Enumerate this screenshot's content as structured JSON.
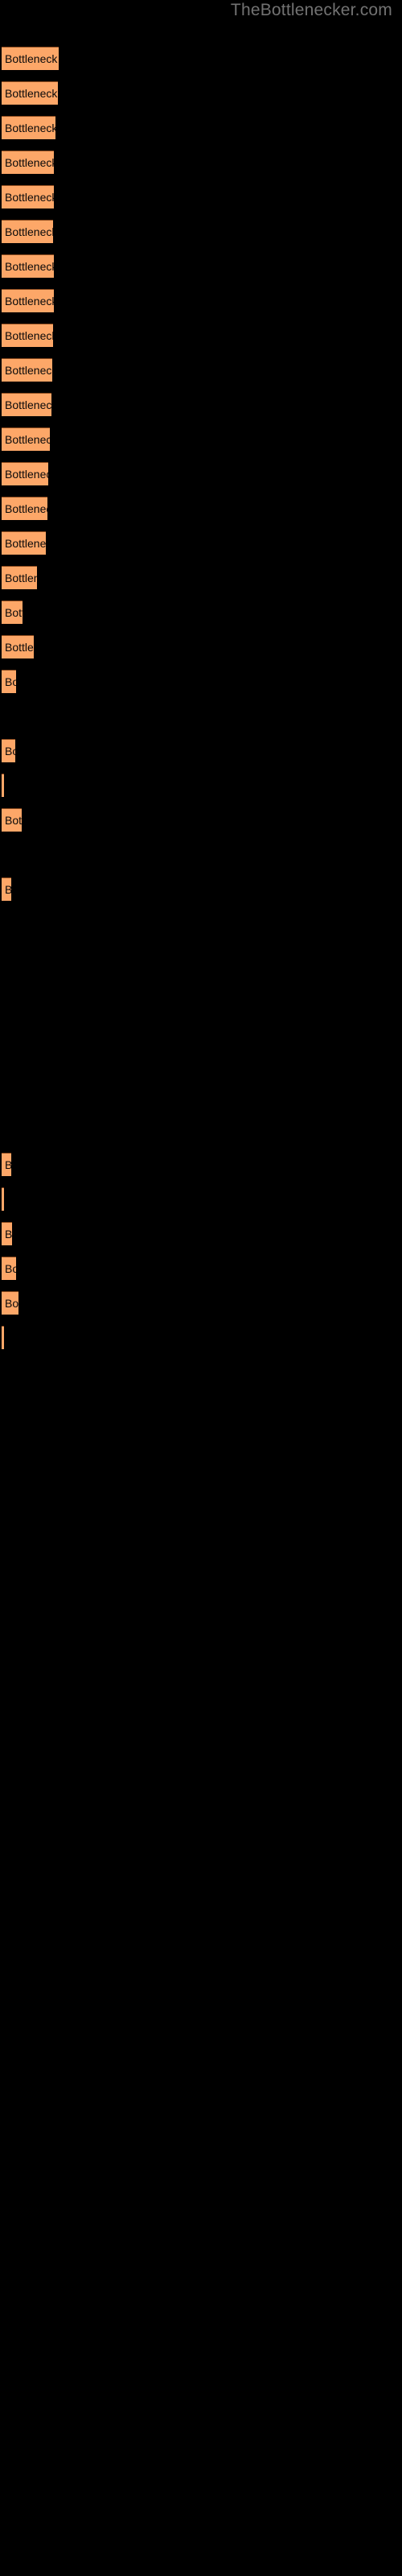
{
  "watermark": {
    "text": "TheBottlenecker.com",
    "color": "#727272"
  },
  "colors": {
    "background": "#000000",
    "bar_fill": "#fda768",
    "bar_border_top": "#8a4a1e",
    "bar_label_text": "#0a0a0a"
  },
  "chart_data": {
    "type": "bar",
    "orientation": "horizontal",
    "title": "",
    "subtitle": "",
    "xlabel": "",
    "ylabel": "",
    "grid": false,
    "legend": null,
    "axis_visible": false,
    "tick_labels": [],
    "xlim": [
      0,
      500
    ],
    "bar_label_template": "Bottleneck result",
    "note": "Horizontal bar chart; every bar carries the same clipped in-bar label 'Bottleneck result'. Bar widths in pixels measured from the left edge of the plotting area.",
    "categories": [
      "bar-1",
      "bar-2",
      "bar-3",
      "bar-4",
      "bar-5",
      "bar-6",
      "bar-7",
      "bar-8",
      "bar-9",
      "bar-10",
      "bar-11",
      "bar-12",
      "bar-13",
      "bar-14",
      "bar-15",
      "bar-16",
      "bar-17",
      "bar-18",
      "bar-19",
      "bar-20",
      "bar-21",
      "bar-22",
      "bar-23",
      "bar-24",
      "bar-25",
      "bar-26",
      "bar-27",
      "bar-28",
      "bar-29",
      "bar-30",
      "bar-31",
      "bar-32",
      "bar-33",
      "bar-34",
      "bar-35",
      "bar-36",
      "bar-37",
      "bar-38"
    ],
    "values": [
      71,
      70,
      67,
      65,
      65,
      63,
      65,
      65,
      64,
      62,
      62,
      58,
      57,
      55,
      50,
      44,
      33,
      44,
      27,
      0,
      25,
      10,
      30,
      0,
      18,
      0,
      0,
      0,
      0,
      18,
      10,
      20,
      23,
      25,
      10,
      0,
      0,
      0
    ],
    "labels": [
      "Bottleneck result",
      "Bottleneck result",
      "Bottleneck result",
      "Bottleneck result",
      "Bottleneck result",
      "Bottleneck result",
      "Bottleneck result",
      "Bottleneck result",
      "Bottleneck result",
      "Bottleneck result",
      "Bottleneck result",
      "Bottleneck result",
      "Bottleneck result",
      "Bottleneck result",
      "Bottleneck result",
      "Bottleneck result",
      "Bottleneck result",
      "Bottleneck result",
      "Bottleneck result",
      "",
      "Bottleneck result",
      "Bottleneck result",
      "Bottleneck result",
      "",
      "Bottleneck result",
      "",
      "",
      "",
      "",
      "Bottleneck result",
      "Bottleneck result",
      "Bottleneck result",
      "Bottleneck result",
      "Bottleneck result",
      "Bottleneck result",
      "",
      "",
      ""
    ],
    "tops": [
      58,
      101,
      144,
      187,
      230,
      273,
      316,
      359,
      402,
      445,
      488,
      531,
      574,
      617,
      660,
      703,
      746,
      789,
      832,
      875,
      918,
      961,
      1004,
      1047,
      1090,
      1133,
      1176,
      1219,
      1262,
      1305,
      1348,
      1391,
      1434,
      1477,
      1520,
      1563,
      1606,
      1649
    ]
  },
  "rows": [
    {
      "top": 58,
      "width": 71,
      "label": "Bottleneck result"
    },
    {
      "top": 101,
      "width": 70,
      "label": "Bottleneck result"
    },
    {
      "top": 144,
      "width": 67,
      "label": "Bottleneck result"
    },
    {
      "top": 187,
      "width": 65,
      "label": "Bottleneck result"
    },
    {
      "top": 230,
      "width": 65,
      "label": "Bottleneck result"
    },
    {
      "top": 273,
      "width": 64,
      "label": "Bottleneck result"
    },
    {
      "top": 316,
      "width": 65,
      "label": "Bottleneck result"
    },
    {
      "top": 359,
      "width": 65,
      "label": "Bottleneck result"
    },
    {
      "top": 402,
      "width": 64,
      "label": "Bottleneck result"
    },
    {
      "top": 445,
      "width": 63,
      "label": "Bottleneck result"
    },
    {
      "top": 488,
      "width": 62,
      "label": "Bottleneck result"
    },
    {
      "top": 531,
      "width": 60,
      "label": "Bottleneck result"
    },
    {
      "top": 574,
      "width": 58,
      "label": "Bottleneck result"
    },
    {
      "top": 617,
      "width": 57,
      "label": "Bottleneck result"
    },
    {
      "top": 660,
      "width": 55,
      "label": "Bottleneck result"
    },
    {
      "top": 703,
      "width": 44,
      "label": "Bottleneck result"
    },
    {
      "top": 746,
      "width": 26,
      "label": "Bottleneck result"
    },
    {
      "top": 789,
      "width": 40,
      "label": "Bottleneck result"
    },
    {
      "top": 832,
      "width": 18,
      "label": "Bottleneck result"
    },
    {
      "top": 918,
      "width": 17,
      "label": "Bottleneck result"
    },
    {
      "top": 961,
      "width": 3,
      "label": ""
    },
    {
      "top": 1004,
      "width": 25,
      "label": "Bottleneck result"
    },
    {
      "top": 1090,
      "width": 12,
      "label": "Bottleneck result"
    },
    {
      "top": 1432,
      "width": 12,
      "label": "Bottleneck result"
    },
    {
      "top": 1475,
      "width": 3,
      "label": ""
    },
    {
      "top": 1518,
      "width": 13,
      "label": "Bottleneck result"
    },
    {
      "top": 1561,
      "width": 18,
      "label": "Bottleneck result"
    },
    {
      "top": 1604,
      "width": 21,
      "label": "Bottleneck result"
    },
    {
      "top": 1647,
      "width": 3,
      "label": ""
    }
  ]
}
